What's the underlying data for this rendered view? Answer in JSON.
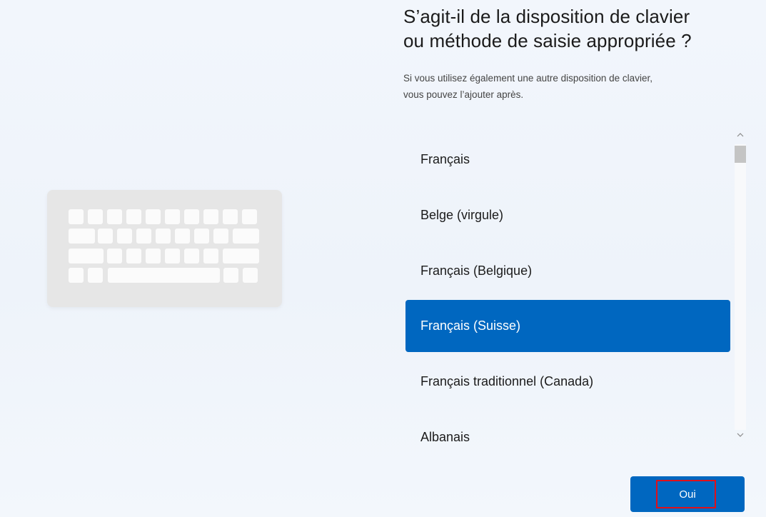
{
  "header": {
    "title_line1": "S’agit-il de la disposition de clavier",
    "title_line2": "ou méthode de saisie appropriée ?"
  },
  "description": {
    "line1": "Si vous utilisez également une autre disposition de clavier,",
    "line2": "vous pouvez l’ajouter après."
  },
  "keyboard_list": {
    "items": [
      {
        "label": "Français"
      },
      {
        "label": "Belge (virgule)"
      },
      {
        "label": "Français (Belgique)"
      },
      {
        "label": "Français (Suisse)"
      },
      {
        "label": "Français traditionnel (Canada)"
      },
      {
        "label": "Albanais"
      }
    ],
    "selected_label": "Français (Suisse)"
  },
  "scrollbar": {
    "up_icon": "chevron-up-icon",
    "down_icon": "chevron-down-icon"
  },
  "actions": {
    "confirm_label": "Oui"
  },
  "illustration": {
    "icon": "keyboard-icon"
  },
  "colors": {
    "accent": "#0067c0",
    "highlight_box": "#e0101a",
    "keyboard_body": "#e6e6e6",
    "key": "#fbfbfb"
  }
}
